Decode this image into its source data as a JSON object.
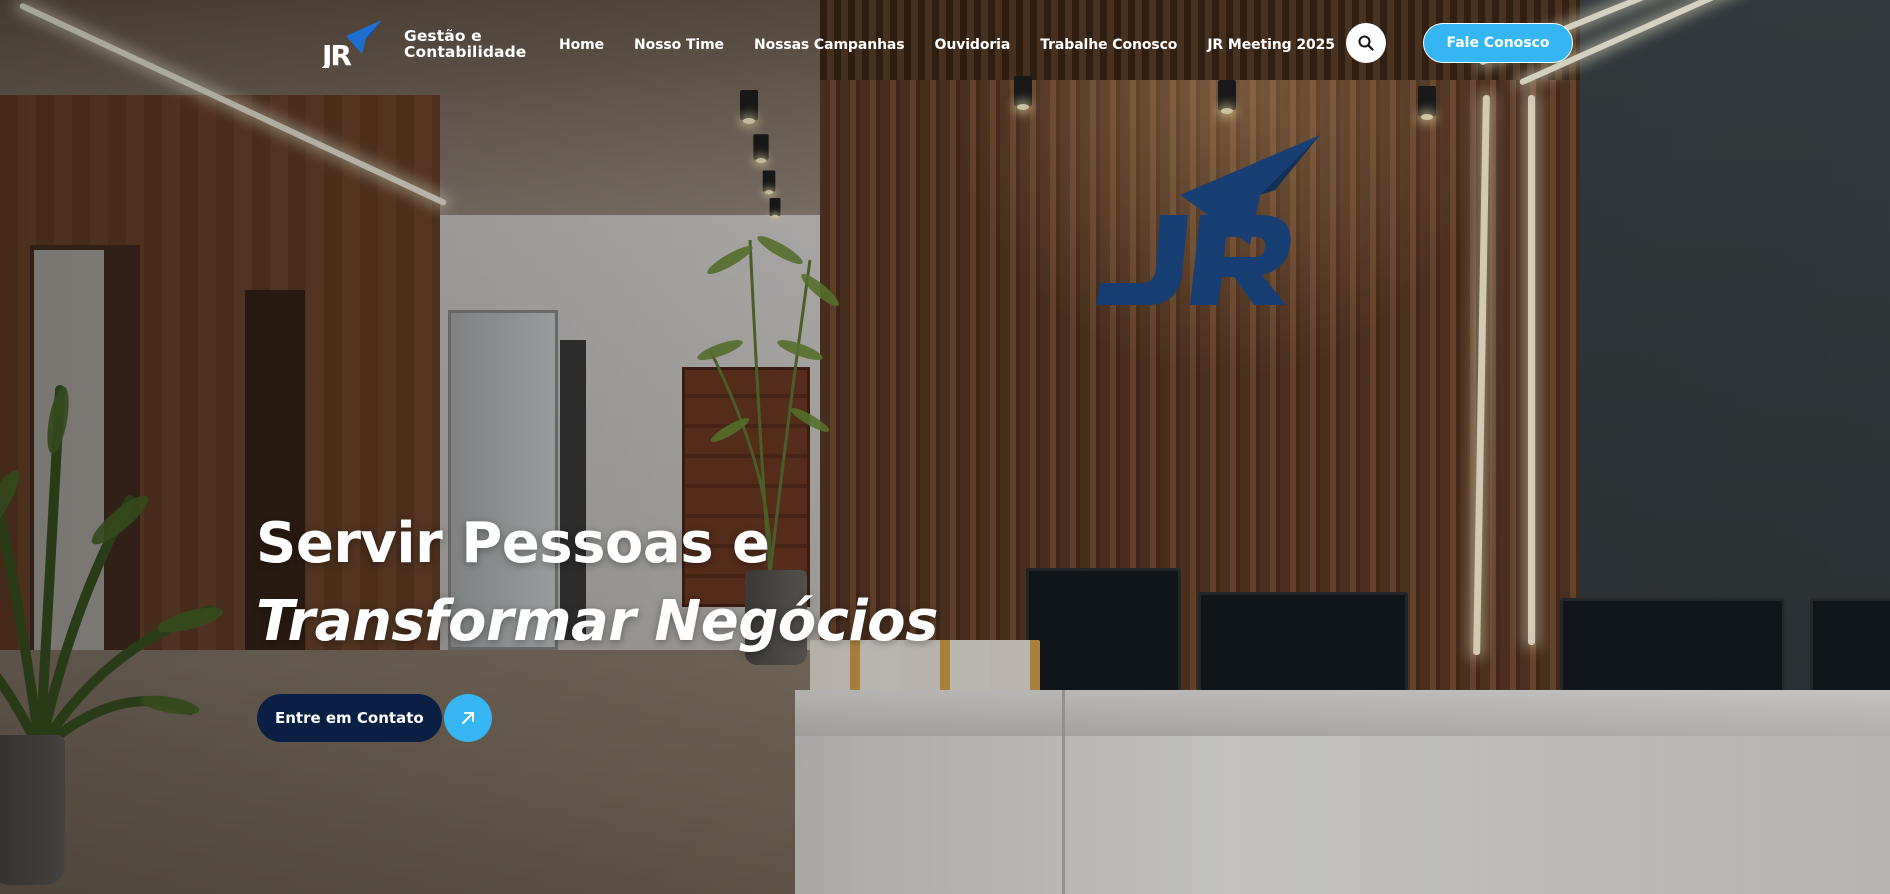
{
  "brand": {
    "logo_letters": "JR",
    "name_line1": "Gestão e",
    "name_line2": "Contabilidade"
  },
  "nav": {
    "items": [
      {
        "label": "Home"
      },
      {
        "label": "Nosso Time"
      },
      {
        "label": "Nossas Campanhas"
      },
      {
        "label": "Ouvidoria"
      },
      {
        "label": "Trabalhe Conosco"
      },
      {
        "label": "JR Meeting 2025"
      }
    ],
    "search_icon": "search-icon",
    "cta_label": "Fale Conosco"
  },
  "hero": {
    "headline_line1": "Servir Pessoas e",
    "headline_line2": "Transformar Negócios",
    "cta_label": "Entre em Contato",
    "cta_icon": "arrow-up-right-icon"
  },
  "colors": {
    "accent": "#36b5f3",
    "navy": "#0b1f45",
    "logo_blue": "#1d4e8f"
  }
}
